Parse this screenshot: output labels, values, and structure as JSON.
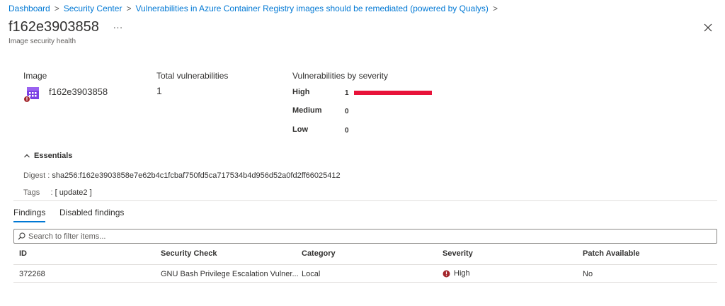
{
  "breadcrumb": {
    "items": [
      "Dashboard",
      "Security Center",
      "Vulnerabilities in Azure Container Registry images should be remediated (powered by Qualys)"
    ],
    "separator": ">"
  },
  "header": {
    "title": "f162e3903858",
    "more_label": "...",
    "subtitle": "Image security health"
  },
  "summary": {
    "image_label": "Image",
    "image_name": "f162e3903858",
    "total_label": "Total vulnerabilities",
    "total_value": "1",
    "severity_label": "Vulnerabilities by severity",
    "severities": [
      {
        "name": "High",
        "count": "1",
        "bar_fraction": 1.0
      },
      {
        "name": "Medium",
        "count": "0",
        "bar_fraction": 0
      },
      {
        "name": "Low",
        "count": "0",
        "bar_fraction": 0
      }
    ],
    "high_color": "#e8133a"
  },
  "essentials": {
    "label": "Essentials",
    "digest_key": "Digest",
    "digest_value": "sha256:f162e3903858e7e62b4c1fcbaf750fd5ca717534b4d956d52a0fd2ff66025412",
    "tags_key": "Tags",
    "tags_value": "[ update2 ]"
  },
  "tabs": [
    "Findings",
    "Disabled findings"
  ],
  "filter": {
    "placeholder": "Search to filter items..."
  },
  "table": {
    "columns": [
      "ID",
      "Security Check",
      "Category",
      "Severity",
      "Patch Available"
    ],
    "rows": [
      {
        "id": "372268",
        "check": "GNU Bash Privilege Escalation Vulner...",
        "category": "Local",
        "severity": "High",
        "patch": "No"
      }
    ]
  },
  "colors": {
    "accent": "#0078d4",
    "danger": "#a4262c"
  }
}
